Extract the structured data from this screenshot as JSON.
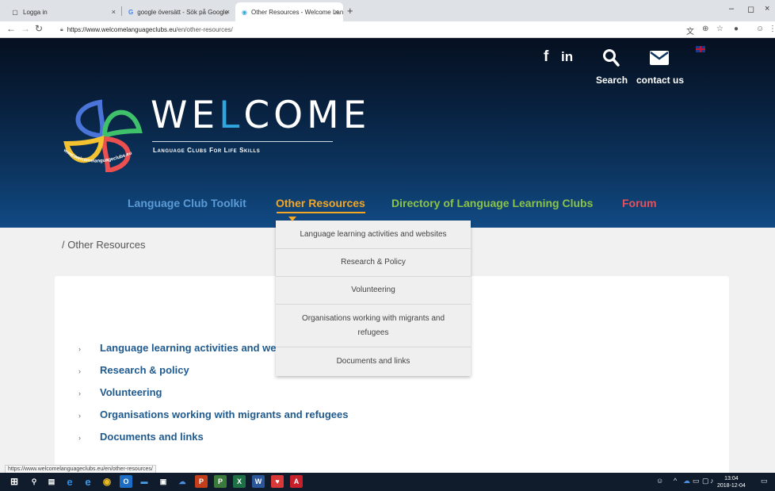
{
  "browser": {
    "tabs": [
      {
        "title": "Logga in"
      },
      {
        "title": "google översätt - Sök på Google"
      },
      {
        "title": "Other Resources - Welcome Lang"
      }
    ],
    "new_tab": "+",
    "tab_close": "×",
    "url_domain": "https://www.welcomelanguageclubs.eu",
    "url_path": "/en/other-resources/",
    "window_controls": {
      "minimize": "–",
      "maximize": "◻",
      "close": "×"
    }
  },
  "header": {
    "social": {
      "facebook": "f",
      "linkedin": "in"
    },
    "search_label": "Search",
    "contact_label": "contact us",
    "logo": {
      "title_a": "WE",
      "title_hl": "L",
      "title_b": "COME",
      "tagline": "Language Clubs For Life Skills",
      "ring_text": "www.welcomelanguageclubs.eu"
    }
  },
  "nav": {
    "items": [
      {
        "label": "Language Club Toolkit",
        "color": "#5b9bd5"
      },
      {
        "label": "Other Resources",
        "color": "#f5a623"
      },
      {
        "label": "Directory of Language Learning Clubs",
        "color": "#8bc34a"
      },
      {
        "label": "Forum",
        "color": "#e8505b"
      }
    ]
  },
  "dropdown": {
    "items": [
      "Language learning activities and websites",
      "Research & Policy",
      "Volunteering",
      "Organisations working with migrants and refugees",
      "Documents and links"
    ]
  },
  "breadcrumb": "/ Other Resources",
  "resources": {
    "bullet": "›",
    "items": [
      "Language learning activities and we",
      "Research & policy",
      "Volunteering",
      "Organisations working with migrants and refugees",
      "Documents and links"
    ]
  },
  "status_url": "https://www.welcomelanguageclubs.eu/en/other-resources/",
  "taskbar": {
    "clock_time": "13:04",
    "clock_date": "2018-12-04"
  },
  "colors": {
    "header_top": "#061020",
    "header_bottom": "#114a84",
    "accent_orange": "#f5a623",
    "link_blue": "#1f5a8f"
  }
}
